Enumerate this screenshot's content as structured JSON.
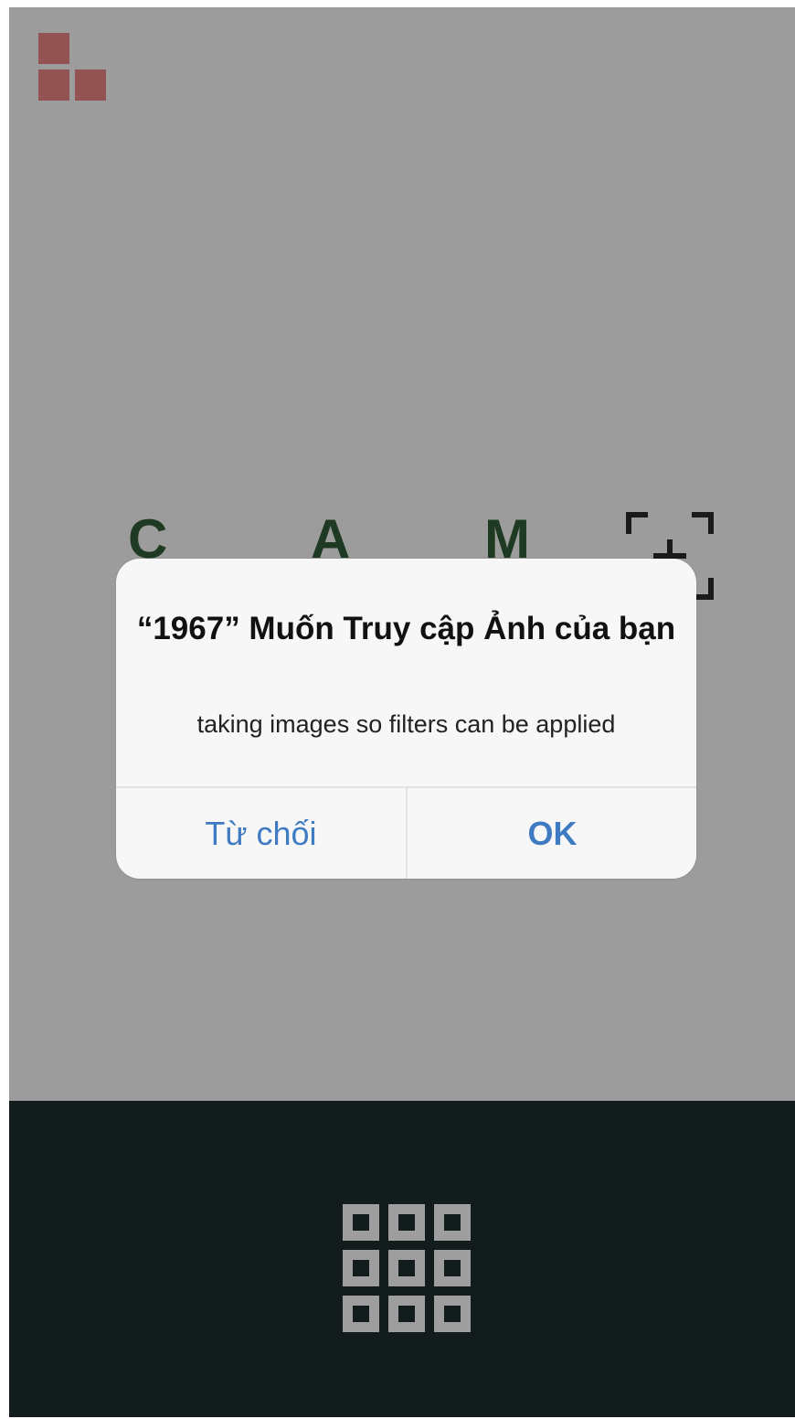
{
  "app": {
    "logo_icon": "tetris-block-logo-icon",
    "logo_color": "#935353",
    "background_color": "#9c9c9c"
  },
  "camera_title": {
    "letters": [
      "C",
      "A",
      "M"
    ]
  },
  "scan_icon": "focus-frame-plus-icon",
  "bottom_bar": {
    "grid_icon": "grid-3x3-icon",
    "background_color": "#121c1c"
  },
  "alert": {
    "title": "“1967” Muốn Truy cập Ảnh của bạn",
    "message": "taking images so filters can be applied",
    "deny_label": "Từ chối",
    "ok_label": "OK",
    "button_color": "#3f7bc2"
  }
}
